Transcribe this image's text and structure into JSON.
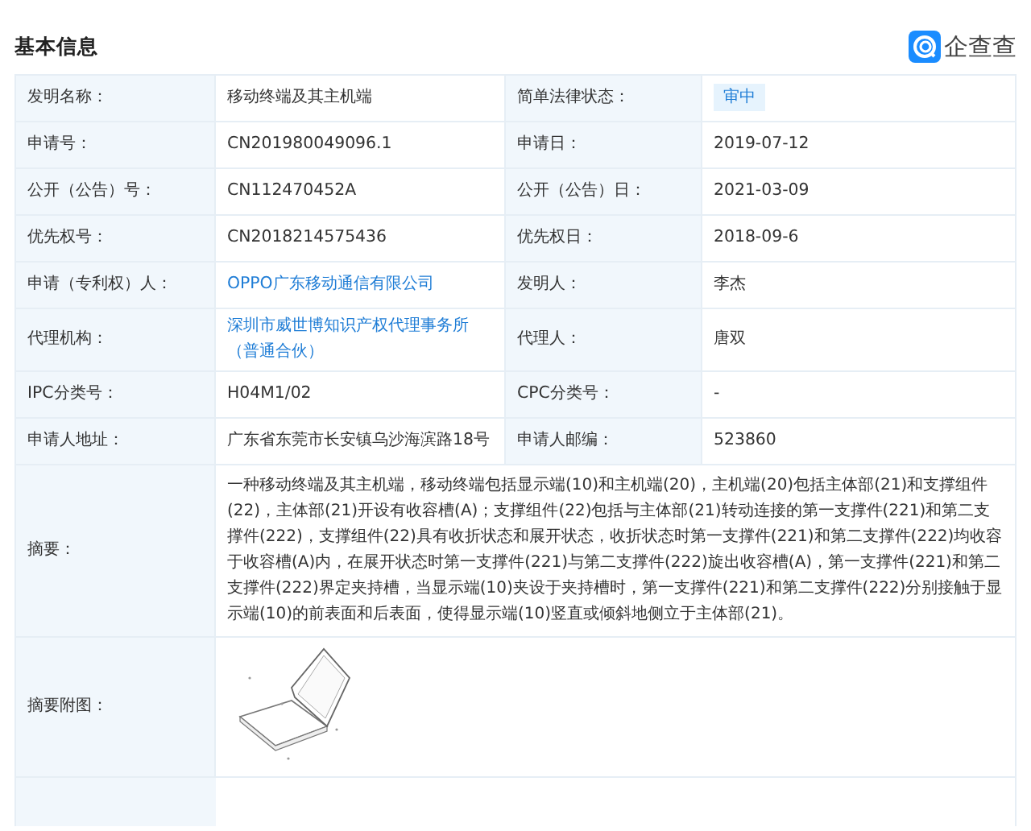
{
  "title": "基本信息",
  "logo": {
    "text": "企查查"
  },
  "rows": [
    {
      "fields": [
        {
          "label": "发明名称：",
          "kind": "text",
          "value": "移动终端及其主机端"
        },
        {
          "label": "简单法律状态：",
          "kind": "badge",
          "value": "审中"
        }
      ]
    },
    {
      "fields": [
        {
          "label": "申请号：",
          "kind": "text",
          "value": "CN201980049096.1"
        },
        {
          "label": "申请日：",
          "kind": "text",
          "value": "2019-07-12"
        }
      ]
    },
    {
      "fields": [
        {
          "label": "公开（公告）号：",
          "kind": "text",
          "value": "CN112470452A"
        },
        {
          "label": "公开（公告）日：",
          "kind": "text",
          "value": "2021-03-09"
        }
      ]
    },
    {
      "fields": [
        {
          "label": "优先权号：",
          "kind": "text",
          "value": "CN2018214575436"
        },
        {
          "label": "优先权日：",
          "kind": "text",
          "value": "2018-09-6"
        }
      ]
    },
    {
      "fields": [
        {
          "label": "申请（专利权）人：",
          "kind": "link",
          "value": "OPPO广东移动通信有限公司"
        },
        {
          "label": "发明人：",
          "kind": "text",
          "value": "李杰"
        }
      ]
    },
    {
      "fields": [
        {
          "label": "代理机构：",
          "kind": "link",
          "value": "深圳市威世博知识产权代理事务所（普通合伙）"
        },
        {
          "label": "代理人：",
          "kind": "text",
          "value": "唐双"
        }
      ]
    },
    {
      "fields": [
        {
          "label": "IPC分类号：",
          "kind": "text",
          "value": "H04M1/02"
        },
        {
          "label": "CPC分类号：",
          "kind": "text",
          "value": "-"
        }
      ]
    },
    {
      "fields": [
        {
          "label": "申请人地址：",
          "kind": "text",
          "value": "广东省东莞市长安镇乌沙海滨路18号"
        },
        {
          "label": "申请人邮编：",
          "kind": "text",
          "value": "523860"
        }
      ]
    },
    {
      "fields": [
        {
          "label": "摘要：",
          "kind": "text",
          "value": "一种移动终端及其主机端，移动终端包括显示端(10)和主机端(20)，主机端(20)包括主体部(21)和支撑组件(22)，主体部(21)开设有收容槽(A)；支撑组件(22)包括与主体部(21)转动连接的第一支撑件(221)和第二支撑件(222)，支撑组件(22)具有收折状态和展开状态，收折状态时第一支撑件(221)和第二支撑件(222)均收容于收容槽(A)内，在展开状态时第一支撑件(221)与第二支撑件(222)旋出收容槽(A)，第一支撑件(221)和第二支撑件(222)界定夹持槽，当显示端(10)夹设于夹持槽时，第一支撑件(221)和第二支撑件(222)分别接触于显示端(10)的前表面和后表面，使得显示端(10)竖直或倾斜地侧立于主体部(21)。"
        }
      ]
    },
    {
      "fields": [
        {
          "label": "摘要附图：",
          "kind": "picture"
        }
      ]
    }
  ]
}
